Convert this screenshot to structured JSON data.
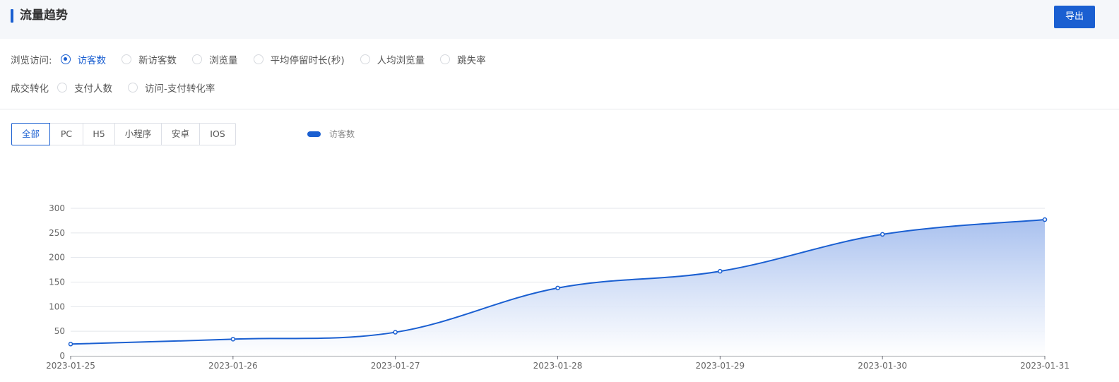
{
  "header": {
    "title": "流量趋势",
    "export_label": "导出"
  },
  "filters": {
    "browse": {
      "label": "浏览访问:",
      "options": [
        "访客数",
        "新访客数",
        "浏览量",
        "平均停留时长(秒)",
        "人均浏览量",
        "跳失率"
      ],
      "selected": "访客数"
    },
    "conversion": {
      "label": "成交转化",
      "options": [
        "支付人数",
        "访问-支付转化率"
      ]
    }
  },
  "tabs": {
    "items": [
      "全部",
      "PC",
      "H5",
      "小程序",
      "安卓",
      "IOS"
    ],
    "active": "全部"
  },
  "colors": {
    "accent": "#1a5fd1",
    "area_top": "#a9c1ef",
    "area_bottom": "#ffffff"
  },
  "chart_data": {
    "type": "area",
    "x": [
      "2023-01-25",
      "2023-01-26",
      "2023-01-27",
      "2023-01-28",
      "2023-01-29",
      "2023-01-30",
      "2023-01-31"
    ],
    "series": [
      {
        "name": "访客数",
        "values": [
          24,
          34,
          48,
          138,
          172,
          247,
          277
        ]
      }
    ],
    "ylim": [
      0,
      300
    ],
    "yticks": [
      0,
      50,
      100,
      150,
      200,
      250,
      300
    ],
    "grid": true,
    "legend": "top",
    "smooth": true
  }
}
